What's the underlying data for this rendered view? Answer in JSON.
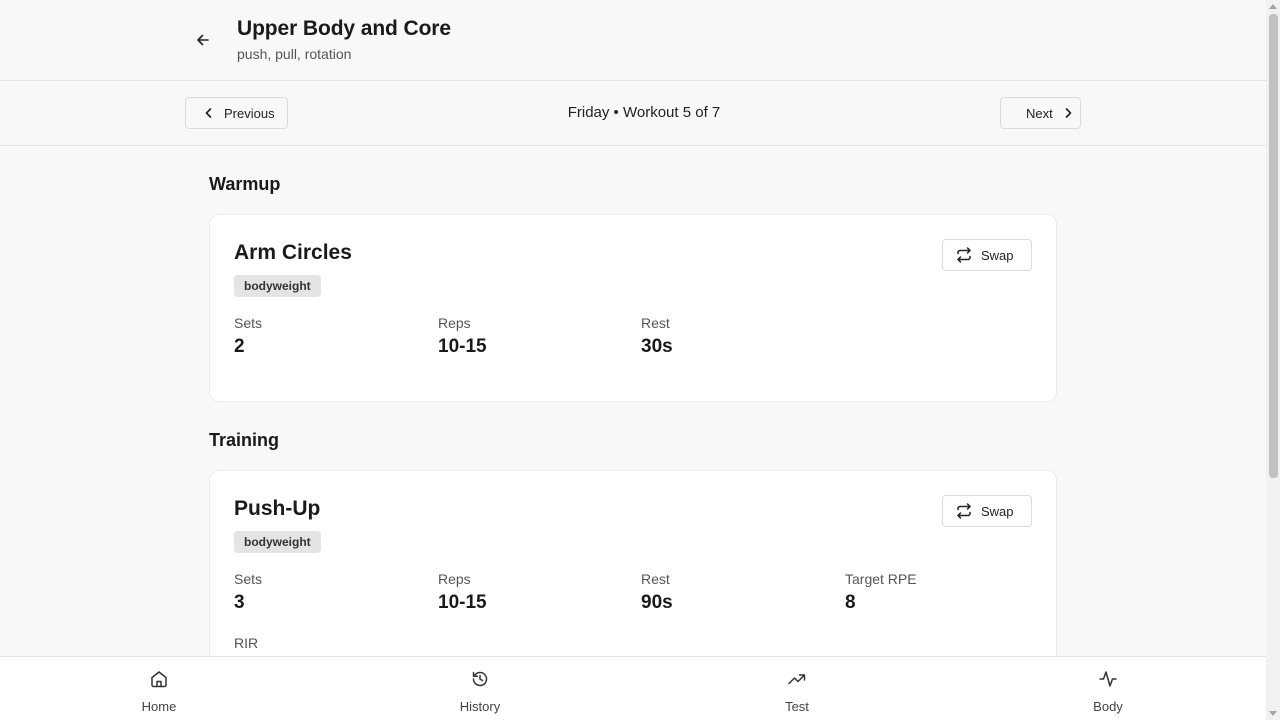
{
  "header": {
    "title": "Upper Body and Core",
    "subtitle": "push, pull, rotation",
    "back_icon": "arrow-left-icon"
  },
  "navbar": {
    "previous_label": "Previous",
    "next_label": "Next",
    "center_label": "Friday • Workout 5 of 7"
  },
  "sections": [
    {
      "title": "Warmup",
      "exercises": [
        {
          "name": "Arm Circles",
          "tag": "bodyweight",
          "swap_label": "Swap",
          "stats": [
            {
              "label": "Sets",
              "value": "2"
            },
            {
              "label": "Reps",
              "value": "10-15"
            },
            {
              "label": "Rest",
              "value": "30s"
            }
          ]
        }
      ]
    },
    {
      "title": "Training",
      "exercises": [
        {
          "name": "Push-Up",
          "tag": "bodyweight",
          "swap_label": "Swap",
          "stats": [
            {
              "label": "Sets",
              "value": "3"
            },
            {
              "label": "Reps",
              "value": "10-15"
            },
            {
              "label": "Rest",
              "value": "90s"
            },
            {
              "label": "Target RPE",
              "value": "8"
            },
            {
              "label": "RIR",
              "value": ""
            }
          ]
        }
      ]
    }
  ],
  "bottom_nav": [
    {
      "label": "Home",
      "icon": "home-icon"
    },
    {
      "label": "History",
      "icon": "history-icon"
    },
    {
      "label": "Test",
      "icon": "trending-up-icon"
    },
    {
      "label": "Body",
      "icon": "activity-icon"
    }
  ]
}
